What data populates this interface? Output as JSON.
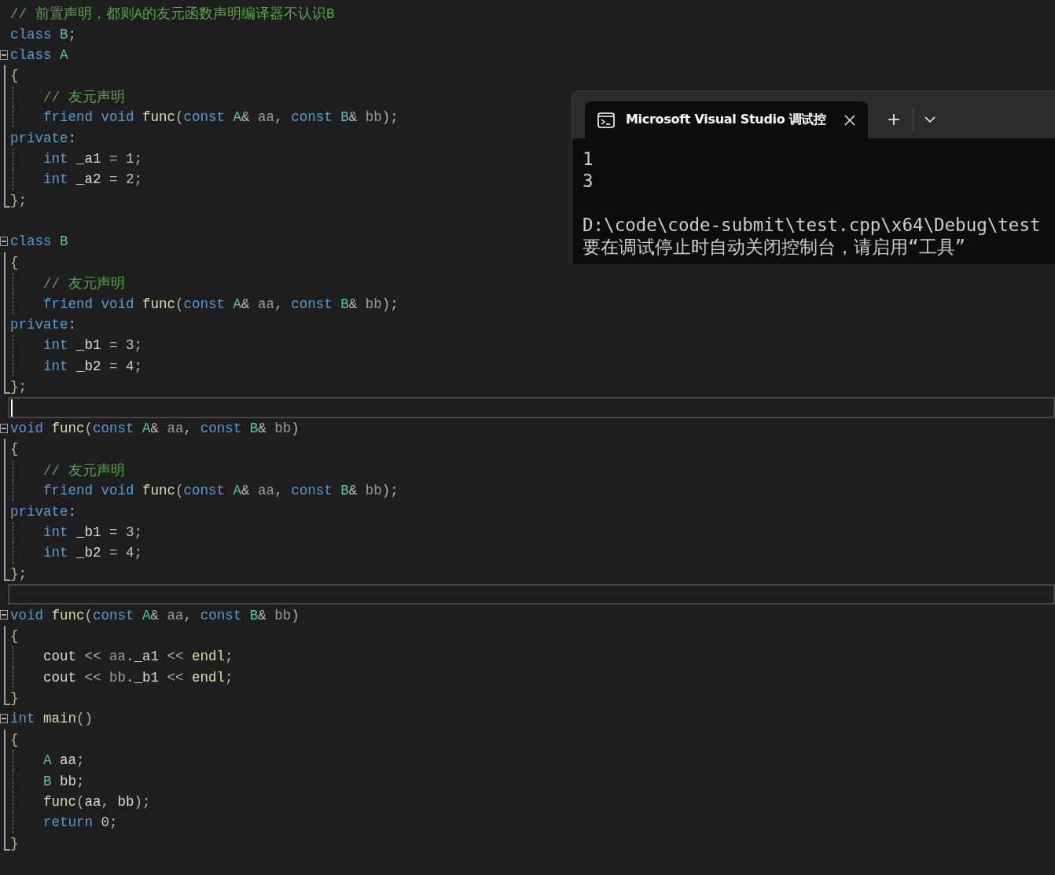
{
  "editor": {
    "lines": [
      {
        "collapsible": false,
        "in_block": false,
        "block_end": false,
        "guide": false,
        "highlighted": false,
        "caret": false,
        "tokens": [
          {
            "text": "// 前置声明，都则A的友元函数声明编译器不认识B",
            "kind": "comment"
          }
        ]
      },
      {
        "collapsible": false,
        "in_block": false,
        "block_end": false,
        "guide": false,
        "highlighted": false,
        "caret": false,
        "tokens": [
          {
            "text": "class ",
            "kind": "keyword"
          },
          {
            "text": "B",
            "kind": "type"
          },
          {
            "text": ";",
            "kind": "punct"
          }
        ]
      },
      {
        "collapsible": true,
        "in_block": false,
        "block_end": false,
        "guide": false,
        "highlighted": false,
        "caret": false,
        "tokens": [
          {
            "text": "class ",
            "kind": "keyword"
          },
          {
            "text": "A",
            "kind": "type"
          }
        ]
      },
      {
        "collapsible": false,
        "in_block": true,
        "block_end": false,
        "guide": false,
        "highlighted": false,
        "caret": false,
        "tokens": [
          {
            "text": "{",
            "kind": "brace"
          }
        ]
      },
      {
        "collapsible": false,
        "in_block": true,
        "block_end": false,
        "guide": true,
        "highlighted": false,
        "caret": false,
        "tokens": [
          {
            "text": "    // 友元声明",
            "kind": "comment"
          }
        ]
      },
      {
        "collapsible": false,
        "in_block": true,
        "block_end": false,
        "guide": true,
        "highlighted": false,
        "caret": false,
        "tokens": [
          {
            "text": "    friend void ",
            "kind": "keyword"
          },
          {
            "text": "func",
            "kind": "function"
          },
          {
            "text": "(",
            "kind": "punct"
          },
          {
            "text": "const ",
            "kind": "keyword"
          },
          {
            "text": "A",
            "kind": "type"
          },
          {
            "text": "& ",
            "kind": "punct"
          },
          {
            "text": "aa",
            "kind": "param"
          },
          {
            "text": ", ",
            "kind": "punct"
          },
          {
            "text": "const ",
            "kind": "keyword"
          },
          {
            "text": "B",
            "kind": "type"
          },
          {
            "text": "& ",
            "kind": "punct"
          },
          {
            "text": "bb",
            "kind": "param"
          },
          {
            "text": ");",
            "kind": "punct"
          }
        ]
      },
      {
        "collapsible": false,
        "in_block": true,
        "block_end": false,
        "guide": false,
        "highlighted": false,
        "caret": false,
        "tokens": [
          {
            "text": "private",
            "kind": "keyword"
          },
          {
            "text": ":",
            "kind": "punct"
          }
        ]
      },
      {
        "collapsible": false,
        "in_block": true,
        "block_end": false,
        "guide": true,
        "highlighted": false,
        "caret": false,
        "tokens": [
          {
            "text": "    int ",
            "kind": "keyword"
          },
          {
            "text": "_a1 ",
            "kind": "plain"
          },
          {
            "text": "= ",
            "kind": "punct"
          },
          {
            "text": "1",
            "kind": "number"
          },
          {
            "text": ";",
            "kind": "punct"
          }
        ]
      },
      {
        "collapsible": false,
        "in_block": true,
        "block_end": false,
        "guide": true,
        "highlighted": false,
        "caret": false,
        "tokens": [
          {
            "text": "    int ",
            "kind": "keyword"
          },
          {
            "text": "_a2 ",
            "kind": "plain"
          },
          {
            "text": "= ",
            "kind": "punct"
          },
          {
            "text": "2",
            "kind": "number"
          },
          {
            "text": ";",
            "kind": "punct"
          }
        ]
      },
      {
        "collapsible": false,
        "in_block": false,
        "block_end": true,
        "guide": false,
        "highlighted": false,
        "caret": false,
        "tokens": [
          {
            "text": "}",
            "kind": "brace"
          },
          {
            "text": ";",
            "kind": "punct"
          }
        ]
      },
      {
        "collapsible": false,
        "in_block": false,
        "block_end": false,
        "guide": false,
        "highlighted": false,
        "caret": false
      },
      {
        "collapsible": true,
        "in_block": false,
        "block_end": false,
        "guide": false,
        "highlighted": false,
        "caret": false,
        "tokens": [
          {
            "text": "class ",
            "kind": "keyword"
          },
          {
            "text": "B",
            "kind": "type"
          }
        ]
      },
      {
        "collapsible": false,
        "in_block": true,
        "block_end": false,
        "guide": false,
        "highlighted": false,
        "caret": false,
        "tokens": [
          {
            "text": "{",
            "kind": "brace"
          }
        ]
      },
      {
        "collapsible": false,
        "in_block": true,
        "block_end": false,
        "guide": true,
        "highlighted": false,
        "caret": false,
        "tokens": [
          {
            "text": "    // 友元声明",
            "kind": "comment"
          }
        ]
      },
      {
        "collapsible": false,
        "in_block": true,
        "block_end": false,
        "guide": true,
        "highlighted": false,
        "caret": false,
        "tokens": [
          {
            "text": "    friend void ",
            "kind": "keyword"
          },
          {
            "text": "func",
            "kind": "function"
          },
          {
            "text": "(",
            "kind": "punct"
          },
          {
            "text": "const ",
            "kind": "keyword"
          },
          {
            "text": "A",
            "kind": "type"
          },
          {
            "text": "& ",
            "kind": "punct"
          },
          {
            "text": "aa",
            "kind": "param"
          },
          {
            "text": ", ",
            "kind": "punct"
          },
          {
            "text": "const ",
            "kind": "keyword"
          },
          {
            "text": "B",
            "kind": "type"
          },
          {
            "text": "& ",
            "kind": "punct"
          },
          {
            "text": "bb",
            "kind": "param"
          },
          {
            "text": ");",
            "kind": "punct"
          }
        ]
      },
      {
        "collapsible": false,
        "in_block": true,
        "block_end": false,
        "guide": false,
        "highlighted": false,
        "caret": false,
        "tokens": [
          {
            "text": "private",
            "kind": "keyword"
          },
          {
            "text": ":",
            "kind": "punct"
          }
        ]
      },
      {
        "collapsible": false,
        "in_block": true,
        "block_end": false,
        "guide": true,
        "highlighted": false,
        "caret": false,
        "tokens": [
          {
            "text": "    int ",
            "kind": "keyword"
          },
          {
            "text": "_b1 ",
            "kind": "plain"
          },
          {
            "text": "= ",
            "kind": "punct"
          },
          {
            "text": "3",
            "kind": "number"
          },
          {
            "text": ";",
            "kind": "punct"
          }
        ]
      },
      {
        "collapsible": false,
        "in_block": true,
        "block_end": false,
        "guide": true,
        "highlighted": false,
        "caret": false,
        "tokens": [
          {
            "text": "    int ",
            "kind": "keyword"
          },
          {
            "text": "_b2 ",
            "kind": "plain"
          },
          {
            "text": "= ",
            "kind": "punct"
          },
          {
            "text": "4",
            "kind": "number"
          },
          {
            "text": ";",
            "kind": "punct"
          }
        ]
      },
      {
        "collapsible": false,
        "in_block": false,
        "block_end": true,
        "guide": false,
        "highlighted": false,
        "caret": false,
        "tokens": [
          {
            "text": "}",
            "kind": "brace"
          },
          {
            "text": ";",
            "kind": "punct"
          }
        ]
      },
      {
        "collapsible": false,
        "in_block": false,
        "block_end": false,
        "guide": false,
        "highlighted": true,
        "caret": true
      },
      {
        "collapsible": true,
        "in_block": false,
        "block_end": false,
        "guide": false,
        "highlighted": false,
        "caret": false,
        "tokens": [
          {
            "text": "void ",
            "kind": "keyword"
          },
          {
            "text": "func",
            "kind": "function"
          },
          {
            "text": "(",
            "kind": "punct"
          },
          {
            "text": "const ",
            "kind": "keyword"
          },
          {
            "text": "A",
            "kind": "type"
          },
          {
            "text": "& ",
            "kind": "punct"
          },
          {
            "text": "aa",
            "kind": "param"
          },
          {
            "text": ", ",
            "kind": "punct"
          },
          {
            "text": "const ",
            "kind": "keyword"
          },
          {
            "text": "B",
            "kind": "type"
          },
          {
            "text": "& ",
            "kind": "punct"
          },
          {
            "text": "bb",
            "kind": "param"
          },
          {
            "text": ")",
            "kind": "punct"
          }
        ]
      },
      {
        "collapsible": false,
        "in_block": true,
        "block_end": false,
        "guide": false,
        "highlighted": false,
        "caret": false,
        "tokens": [
          {
            "text": "{",
            "kind": "brace"
          }
        ]
      },
      {
        "collapsible": false,
        "in_block": true,
        "block_end": false,
        "guide": true,
        "highlighted": false,
        "caret": false,
        "tokens": [
          {
            "text": "    // 友元声明",
            "kind": "comment"
          }
        ]
      },
      {
        "collapsible": false,
        "in_block": true,
        "block_end": false,
        "guide": true,
        "highlighted": false,
        "caret": false,
        "tokens": [
          {
            "text": "    friend void ",
            "kind": "keyword"
          },
          {
            "text": "func",
            "kind": "function"
          },
          {
            "text": "(",
            "kind": "punct"
          },
          {
            "text": "const ",
            "kind": "keyword"
          },
          {
            "text": "A",
            "kind": "type"
          },
          {
            "text": "& ",
            "kind": "punct"
          },
          {
            "text": "aa",
            "kind": "param"
          },
          {
            "text": ", ",
            "kind": "punct"
          },
          {
            "text": "const ",
            "kind": "keyword"
          },
          {
            "text": "B",
            "kind": "type"
          },
          {
            "text": "& ",
            "kind": "punct"
          },
          {
            "text": "bb",
            "kind": "param"
          },
          {
            "text": ");",
            "kind": "punct"
          }
        ]
      },
      {
        "collapsible": false,
        "in_block": true,
        "block_end": false,
        "guide": false,
        "highlighted": false,
        "caret": false,
        "tokens": [
          {
            "text": "private",
            "kind": "keyword"
          },
          {
            "text": ":",
            "kind": "punct"
          }
        ]
      },
      {
        "collapsible": false,
        "in_block": true,
        "block_end": false,
        "guide": true,
        "highlighted": false,
        "caret": false,
        "tokens": [
          {
            "text": "    int ",
            "kind": "keyword"
          },
          {
            "text": "_b1 ",
            "kind": "plain"
          },
          {
            "text": "= ",
            "kind": "punct"
          },
          {
            "text": "3",
            "kind": "number"
          },
          {
            "text": ";",
            "kind": "punct"
          }
        ]
      },
      {
        "collapsible": false,
        "in_block": true,
        "block_end": false,
        "guide": true,
        "highlighted": false,
        "caret": false,
        "tokens": [
          {
            "text": "    int ",
            "kind": "keyword"
          },
          {
            "text": "_b2 ",
            "kind": "plain"
          },
          {
            "text": "= ",
            "kind": "punct"
          },
          {
            "text": "4",
            "kind": "number"
          },
          {
            "text": ";",
            "kind": "punct"
          }
        ]
      },
      {
        "collapsible": false,
        "in_block": false,
        "block_end": true,
        "guide": false,
        "highlighted": false,
        "caret": false,
        "tokens": [
          {
            "text": "}",
            "kind": "brace"
          },
          {
            "text": ";",
            "kind": "punct"
          }
        ]
      },
      {
        "collapsible": false,
        "in_block": false,
        "block_end": false,
        "guide": false,
        "highlighted": true,
        "caret": false
      },
      {
        "collapsible": true,
        "in_block": false,
        "block_end": false,
        "guide": false,
        "highlighted": false,
        "caret": false,
        "tokens": [
          {
            "text": "void ",
            "kind": "keyword"
          },
          {
            "text": "func",
            "kind": "function"
          },
          {
            "text": "(",
            "kind": "punct"
          },
          {
            "text": "const ",
            "kind": "keyword"
          },
          {
            "text": "A",
            "kind": "type"
          },
          {
            "text": "& ",
            "kind": "punct"
          },
          {
            "text": "aa",
            "kind": "param"
          },
          {
            "text": ", ",
            "kind": "punct"
          },
          {
            "text": "const ",
            "kind": "keyword"
          },
          {
            "text": "B",
            "kind": "type"
          },
          {
            "text": "& ",
            "kind": "punct"
          },
          {
            "text": "bb",
            "kind": "param"
          },
          {
            "text": ")",
            "kind": "punct"
          }
        ]
      },
      {
        "collapsible": false,
        "in_block": true,
        "block_end": false,
        "guide": false,
        "highlighted": false,
        "caret": false,
        "tokens": [
          {
            "text": "{",
            "kind": "brace"
          }
        ]
      },
      {
        "collapsible": false,
        "in_block": true,
        "block_end": false,
        "guide": true,
        "highlighted": false,
        "caret": false,
        "tokens": [
          {
            "text": "    cout ",
            "kind": "plain"
          },
          {
            "text": "<< ",
            "kind": "punct"
          },
          {
            "text": "aa",
            "kind": "param"
          },
          {
            "text": ".",
            "kind": "punct"
          },
          {
            "text": "_a1 ",
            "kind": "plain"
          },
          {
            "text": "<< ",
            "kind": "punct"
          },
          {
            "text": "endl",
            "kind": "function"
          },
          {
            "text": ";",
            "kind": "punct"
          }
        ]
      },
      {
        "collapsible": false,
        "in_block": true,
        "block_end": false,
        "guide": true,
        "highlighted": false,
        "caret": false,
        "tokens": [
          {
            "text": "    cout ",
            "kind": "plain"
          },
          {
            "text": "<< ",
            "kind": "punct"
          },
          {
            "text": "bb",
            "kind": "param"
          },
          {
            "text": ".",
            "kind": "punct"
          },
          {
            "text": "_b1 ",
            "kind": "plain"
          },
          {
            "text": "<< ",
            "kind": "punct"
          },
          {
            "text": "endl",
            "kind": "function"
          },
          {
            "text": ";",
            "kind": "punct"
          }
        ]
      },
      {
        "collapsible": false,
        "in_block": false,
        "block_end": true,
        "guide": false,
        "highlighted": false,
        "caret": false,
        "tokens": [
          {
            "text": "}",
            "kind": "brace"
          }
        ]
      },
      {
        "collapsible": true,
        "in_block": false,
        "block_end": false,
        "guide": false,
        "highlighted": false,
        "caret": false,
        "tokens": [
          {
            "text": "int ",
            "kind": "keyword"
          },
          {
            "text": "main",
            "kind": "function"
          },
          {
            "text": "()",
            "kind": "punct"
          }
        ]
      },
      {
        "collapsible": false,
        "in_block": true,
        "block_end": false,
        "guide": false,
        "highlighted": false,
        "caret": false,
        "tokens": [
          {
            "text": "{",
            "kind": "brace"
          }
        ]
      },
      {
        "collapsible": false,
        "in_block": true,
        "block_end": false,
        "guide": true,
        "highlighted": false,
        "caret": false,
        "tokens": [
          {
            "text": "    A ",
            "kind": "type"
          },
          {
            "text": "aa",
            "kind": "plain"
          },
          {
            "text": ";",
            "kind": "punct"
          }
        ]
      },
      {
        "collapsible": false,
        "in_block": true,
        "block_end": false,
        "guide": true,
        "highlighted": false,
        "caret": false,
        "tokens": [
          {
            "text": "    B ",
            "kind": "type"
          },
          {
            "text": "bb",
            "kind": "plain"
          },
          {
            "text": ";",
            "kind": "punct"
          }
        ]
      },
      {
        "collapsible": false,
        "in_block": true,
        "block_end": false,
        "guide": true,
        "highlighted": false,
        "caret": false,
        "tokens": [
          {
            "text": "    func",
            "kind": "function"
          },
          {
            "text": "(",
            "kind": "punct"
          },
          {
            "text": "aa",
            "kind": "plain"
          },
          {
            "text": ", ",
            "kind": "punct"
          },
          {
            "text": "bb",
            "kind": "plain"
          },
          {
            "text": ");",
            "kind": "punct"
          }
        ]
      },
      {
        "collapsible": false,
        "in_block": true,
        "block_end": false,
        "guide": true,
        "highlighted": false,
        "caret": false,
        "tokens": [
          {
            "text": "    return ",
            "kind": "keyword"
          },
          {
            "text": "0",
            "kind": "number"
          },
          {
            "text": ";",
            "kind": "punct"
          }
        ]
      },
      {
        "collapsible": false,
        "in_block": false,
        "block_end": true,
        "guide": false,
        "highlighted": false,
        "caret": false,
        "tokens": [
          {
            "text": "}",
            "kind": "brace"
          }
        ]
      }
    ]
  },
  "terminal": {
    "tab": {
      "title": "Microsoft Visual Studio 调试控"
    },
    "output": [
      "1",
      "3"
    ],
    "message": [
      "D:\\code\\code-submit\\test.cpp\\x64\\Debug\\test",
      "要在调试停止时自动关闭控制台，请启用“工具”"
    ]
  }
}
